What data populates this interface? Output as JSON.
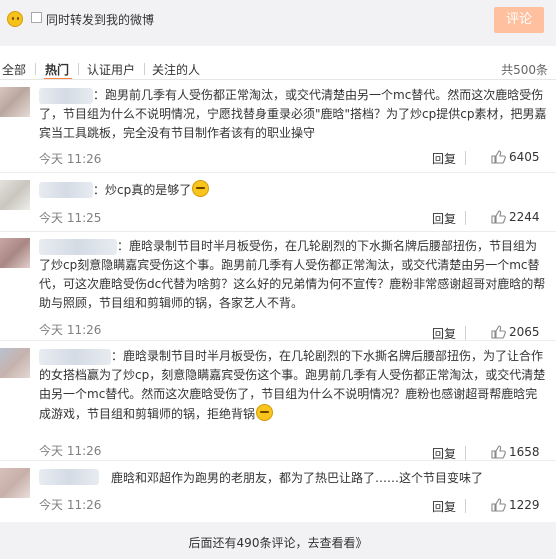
{
  "composer": {
    "forward_label": "同时转发到我的微博",
    "submit_label": "评论",
    "submit_color": "#ffc09f"
  },
  "tabs": {
    "items": [
      "全部",
      "热门",
      "认证用户",
      "关注的人"
    ],
    "active": "热门",
    "total": "共500条"
  },
  "comments": [
    {
      "lines": [
        "：跑男前几季有人受伤都正常淘汰，或交代清楚由另一个mc替代。然而这次鹿晗受伤",
        "了，节目组为什么不说明情况，宁愿找替身重录必须\"鹿晗\"搭档？为了炒cp提供cp素材，把男嘉",
        "宾当工具跳板，完全没有节目制作者该有的职业操守"
      ],
      "time": "今天 11:26",
      "reply": "回复",
      "likes": "6405"
    },
    {
      "lines": [
        "：炒cp真的是够了"
      ],
      "time": "今天 11:25",
      "reply": "回复",
      "likes": "2244"
    },
    {
      "lines": [
        "：鹿晗录制节目时半月板受伤，在几轮剧烈的下水撕名牌后腰部扭伤，节目组为",
        "了炒cp刻意隐瞒嘉宾受伤这个事。跑男前几季有人受伤都正常淘汰，或交代清楚由另一个mc替",
        "代，可这次鹿晗受伤dc代替为啥剪？这么好的兄弟情为何不宣传？鹿粉非常感谢超哥对鹿晗的帮",
        "助与照顾，节目组和剪辑师的锅，各家艺人不背。"
      ],
      "time": "今天 11:26",
      "reply": "回复",
      "likes": "2065"
    },
    {
      "lines": [
        "：鹿晗录制节目时半月板受伤，在几轮剧烈的下水撕名牌后腰部扭伤，为了让合作",
        "的女搭档赢为了炒cp，刻意隐瞒嘉宾受伤这个事。跑男前几季有人受伤都正常淘汰，或交代清楚",
        "由另一个mc替代。然而这次鹿晗受伤了，节目组为什么不说明情况？鹿粉也感谢超哥帮鹿晗完",
        "成游戏，节目组和剪辑师的锅，拒绝背锅"
      ],
      "time": "今天 11:26",
      "reply": "回复",
      "likes": "1658"
    },
    {
      "lines": [
        "鹿晗和邓超作为跑男的老朋友，都为了热巴让路了……这个节目变味了"
      ],
      "time": "今天 11:26",
      "reply": "回复",
      "likes": "1229"
    }
  ],
  "more": "后面还有490条评论，去查看看》"
}
